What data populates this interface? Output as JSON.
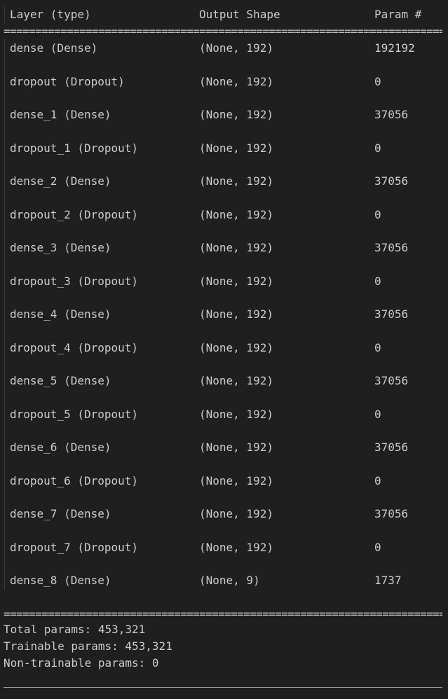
{
  "header": {
    "layer": "Layer (type)",
    "shape": "Output Shape",
    "param": "Param #"
  },
  "separator": "==============================================================================================================",
  "rows": [
    {
      "layer": "dense (Dense)",
      "shape": "(None, 192)",
      "param": "192192"
    },
    {
      "layer": "dropout (Dropout)",
      "shape": "(None, 192)",
      "param": "0"
    },
    {
      "layer": "dense_1 (Dense)",
      "shape": "(None, 192)",
      "param": "37056"
    },
    {
      "layer": "dropout_1 (Dropout)",
      "shape": "(None, 192)",
      "param": "0"
    },
    {
      "layer": "dense_2 (Dense)",
      "shape": "(None, 192)",
      "param": "37056"
    },
    {
      "layer": "dropout_2 (Dropout)",
      "shape": "(None, 192)",
      "param": "0"
    },
    {
      "layer": "dense_3 (Dense)",
      "shape": "(None, 192)",
      "param": "37056"
    },
    {
      "layer": "dropout_3 (Dropout)",
      "shape": "(None, 192)",
      "param": "0"
    },
    {
      "layer": "dense_4 (Dense)",
      "shape": "(None, 192)",
      "param": "37056"
    },
    {
      "layer": "dropout_4 (Dropout)",
      "shape": "(None, 192)",
      "param": "0"
    },
    {
      "layer": "dense_5 (Dense)",
      "shape": "(None, 192)",
      "param": "37056"
    },
    {
      "layer": "dropout_5 (Dropout)",
      "shape": "(None, 192)",
      "param": "0"
    },
    {
      "layer": "dense_6 (Dense)",
      "shape": "(None, 192)",
      "param": "37056"
    },
    {
      "layer": "dropout_6 (Dropout)",
      "shape": "(None, 192)",
      "param": "0"
    },
    {
      "layer": "dense_7 (Dense)",
      "shape": "(None, 192)",
      "param": "37056"
    },
    {
      "layer": "dropout_7 (Dropout)",
      "shape": "(None, 192)",
      "param": "0"
    },
    {
      "layer": "dense_8 (Dense)",
      "shape": "(None, 9)",
      "param": "1737"
    }
  ],
  "summary": {
    "total": "Total params: 453,321",
    "trainable": "Trainable params: 453,321",
    "non_trainable": "Non-trainable params: 0"
  }
}
